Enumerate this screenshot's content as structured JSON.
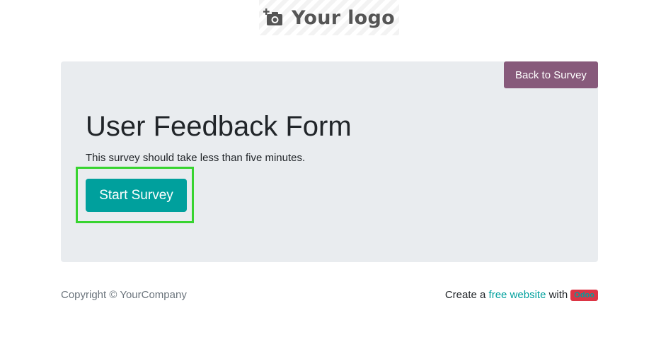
{
  "header": {
    "logo_text": "Your logo",
    "logo_icon": "camera-plus-icon"
  },
  "survey": {
    "back_label": "Back to Survey",
    "title": "User Feedback Form",
    "description": "This survey should take less than five minutes.",
    "start_label": "Start Survey"
  },
  "footer": {
    "copyright": "Copyright © YourCompany",
    "create_prefix": "Create a",
    "link_text": "free website",
    "with_text": "with",
    "badge": "Odoo"
  },
  "colors": {
    "primary": "#00a09d",
    "secondary": "#875a7b",
    "card_bg": "#e9ecef",
    "highlight": "#38d430",
    "badge": "#dc3545"
  }
}
